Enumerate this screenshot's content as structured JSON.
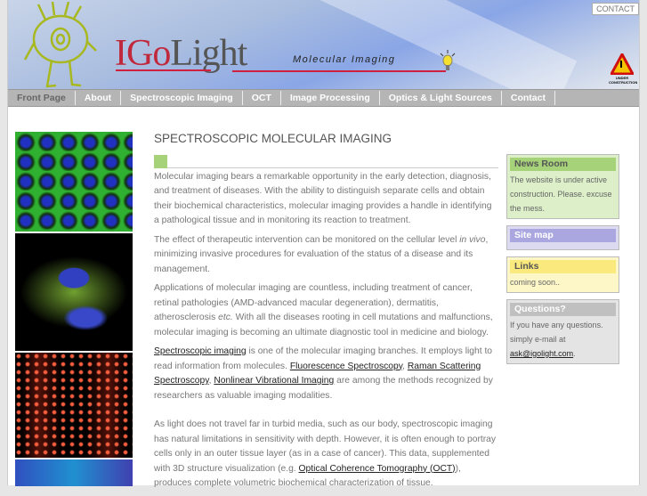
{
  "header": {
    "logo_a": "IGo",
    "logo_b": "Light",
    "tagline": "Molecular Imaging",
    "contact": "CONTACT",
    "under_construction": "UNDER CONSTRUCTION"
  },
  "nav": [
    "Front Page",
    "About",
    "Spectroscopic Imaging",
    "OCT",
    "Image Processing",
    "Optics & Light Sources",
    "Contact"
  ],
  "main": {
    "title": "SPECTROSCOPIC MOLECULAR IMAGING",
    "p1": "Molecular imaging bears a remarkable opportunity in the early detection, diagnosis, and treatment of diseases. With the ability to distinguish separate cells and obtain their biochemical characteristics, molecular imaging provides a handle in identifying a pathological tissue and in monitoring its reaction to treatment.",
    "p2a": "The effect of therapeutic intervention can be monitored on the cellular level ",
    "p2i": "in vivo",
    "p2b": ", minimizing invasive procedures for evaluation of the status of a disease and its management.",
    "p3a": "Applications of molecular imaging are countless, including treatment of cancer, retinal pathologies (AMD-advanced macular degeneration), dermatitis, atherosclerosis ",
    "p3i": "etc.",
    "p3b": " With all the diseases rooting in cell mutations and malfunctions, molecular imaging is becoming an ultimate diagnostic tool in medicine and biology.",
    "p4_link1": "Spectroscopic imaging",
    "p4a": " is one of the molecular imaging branches. It employs light to read information from molecules. ",
    "p4_link2": "Fluorescence Spectroscopy",
    "p4b": ", ",
    "p4_link3": "Raman Scattering Spectroscopy",
    "p4c": ", ",
    "p4_link4": "Nonlinear Vibrational Imaging",
    "p4d": " are among the methods recognized by researchers as valuable imaging modalities.",
    "p5a": "As light does not travel far in turbid media, such as our body, spectroscopic imaging has natural limitations in sensitivity with depth. However, it is often enough to portray cells only in an outer tissue layer (as in a case of cancer). This data, supplemented with 3D structure visualization (e.g. ",
    "p5_link": "Optical Coherence Tomography (OCT)",
    "p5b": "), produces complete volumetric biochemical characterization of tissue."
  },
  "sidebar": {
    "news": {
      "title": "News Room",
      "text": "The website is under active construction. Please. excuse the mess."
    },
    "sitemap": {
      "title": "Site map"
    },
    "links": {
      "title": "Links",
      "text": "coming soon.."
    },
    "questions": {
      "title": "Questions?",
      "text": "If you have any questions. simply e-mail at",
      "email": "ask@igolight.com",
      "end": "."
    }
  }
}
